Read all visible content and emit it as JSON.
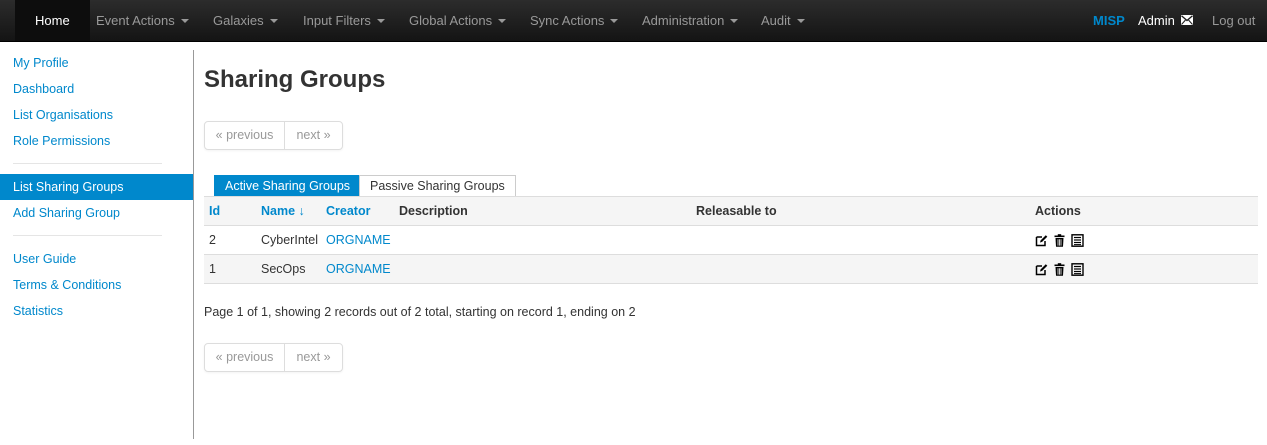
{
  "nav": {
    "home": "Home",
    "items": [
      "Event Actions",
      "Galaxies",
      "Input Filters",
      "Global Actions",
      "Sync Actions",
      "Administration",
      "Audit"
    ],
    "brand": "MISP",
    "user": "Admin",
    "logout": "Log out"
  },
  "sidebar": {
    "group1": [
      "My Profile",
      "Dashboard",
      "List Organisations",
      "Role Permissions"
    ],
    "group2": [
      "List Sharing Groups",
      "Add Sharing Group"
    ],
    "group3": [
      "User Guide",
      "Terms & Conditions",
      "Statistics"
    ],
    "active": "List Sharing Groups"
  },
  "page": {
    "title": "Sharing Groups",
    "pager_prev": "« previous",
    "pager_next": "next »",
    "tabs": [
      "Active Sharing Groups",
      "Passive Sharing Groups"
    ],
    "summary": "Page 1 of 1, showing 2 records out of 2 total, starting on record 1, ending on 2"
  },
  "table": {
    "headers": {
      "id": "Id",
      "name": "Name ↓",
      "creator": "Creator",
      "description": "Description",
      "releasable": "Releasable to",
      "actions": "Actions"
    },
    "rows": [
      {
        "id": "2",
        "name": "CyberIntel",
        "creator": "ORGNAME",
        "description": "",
        "releasable": ""
      },
      {
        "id": "1",
        "name": "SecOps",
        "creator": "ORGNAME",
        "description": "",
        "releasable": ""
      }
    ],
    "action_icons": [
      "edit-icon",
      "delete-icon",
      "view-icon"
    ]
  },
  "colors": {
    "accent": "#0088cc",
    "navbar": "#1b1b1b"
  }
}
